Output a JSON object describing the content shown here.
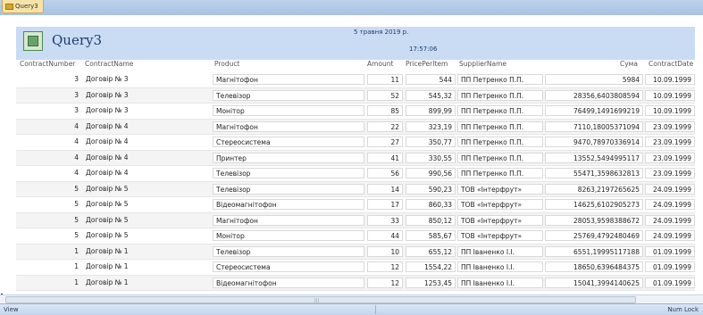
{
  "tab": {
    "label": "Query3"
  },
  "header": {
    "title": "Query3",
    "date": "5 травня 2019 р.",
    "time": "17:57:06"
  },
  "columns": [
    "ContractNumber",
    "ContractName",
    "Product",
    "Amount",
    "PricePerItem",
    "SupplierName",
    "Сума",
    "ContractDate"
  ],
  "rows": [
    [
      "3",
      "Договір № 3",
      "Магнітофон",
      "11",
      "544",
      "ПП Петренко П.П.",
      "5984",
      "10.09.1999"
    ],
    [
      "3",
      "Договір № 3",
      "Телевізор",
      "52",
      "545,32",
      "ПП Петренко П.П.",
      "28356,6403808594",
      "10.09.1999"
    ],
    [
      "3",
      "Договір № 3",
      "Монітор",
      "85",
      "899,99",
      "ПП Петренко П.П.",
      "76499,1491699219",
      "10.09.1999"
    ],
    [
      "4",
      "Договір № 4",
      "Магнітофон",
      "22",
      "323,19",
      "ПП Петренко П.П.",
      "7110,18005371094",
      "23.09.1999"
    ],
    [
      "4",
      "Договір № 4",
      "Стереосистема",
      "27",
      "350,77",
      "ПП Петренко П.П.",
      "9470,78970336914",
      "23.09.1999"
    ],
    [
      "4",
      "Договір № 4",
      "Принтер",
      "41",
      "330,55",
      "ПП Петренко П.П.",
      "13552,5494995117",
      "23.09.1999"
    ],
    [
      "4",
      "Договір № 4",
      "Телевізор",
      "56",
      "990,56",
      "ПП Петренко П.П.",
      "55471,3598632813",
      "23.09.1999"
    ],
    [
      "5",
      "Договір № 5",
      "Телевізор",
      "14",
      "590,23",
      "ТОВ «Інтерфрут»",
      "8263,2197265625",
      "24.09.1999"
    ],
    [
      "5",
      "Договір № 5",
      "Відеомагнітофон",
      "17",
      "860,33",
      "ТОВ «Інтерфрут»",
      "14625,6102905273",
      "24.09.1999"
    ],
    [
      "5",
      "Договір № 5",
      "Магнітофон",
      "33",
      "850,12",
      "ТОВ «Інтерфрут»",
      "28053,9598388672",
      "24.09.1999"
    ],
    [
      "5",
      "Договір № 5",
      "Монітор",
      "44",
      "585,67",
      "ТОВ «Інтерфрут»",
      "25769,4792480469",
      "24.09.1999"
    ],
    [
      "1",
      "Договір № 1",
      "Телевізор",
      "10",
      "655,12",
      "ПП Іваненко І.І.",
      "6551,19995117188",
      "01.09.1999"
    ],
    [
      "1",
      "Договір № 1",
      "Стереосистема",
      "12",
      "1554,22",
      "ПП Іваненко І.І.",
      "18650,6396484375",
      "01.09.1999"
    ],
    [
      "1",
      "Договір № 1",
      "Відеомагнітофон",
      "12",
      "1253,45",
      "ПП Іваненко І.І.",
      "15041,3994140625",
      "01.09.1999"
    ]
  ],
  "status": {
    "view": "View",
    "numlock": "Num Lock"
  }
}
